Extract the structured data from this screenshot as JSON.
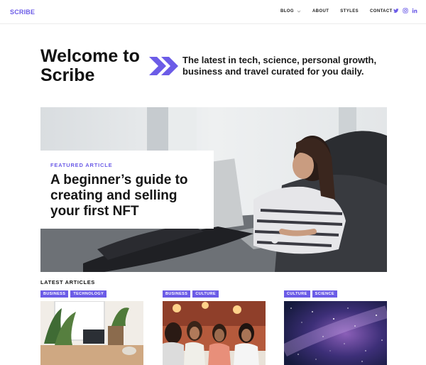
{
  "brand": {
    "name": "SCRIBE",
    "accent": "#6c5ce7"
  },
  "nav": {
    "items": [
      {
        "label": "BLOG",
        "has_dropdown": true
      },
      {
        "label": "ABOUT"
      },
      {
        "label": "STYLES"
      },
      {
        "label": "CONTACT"
      }
    ],
    "socials": [
      "twitter-icon",
      "instagram-icon",
      "linkedin-icon"
    ]
  },
  "hero": {
    "title": "Welcome to Scribe",
    "tagline": "The latest in tech, science, personal growth, business and travel curated for you daily."
  },
  "featured": {
    "label": "FEATURED ARTICLE",
    "title": "A beginner’s guide to creating and selling your first NFT"
  },
  "latest": {
    "heading": "LATEST ARTICLES",
    "articles": [
      {
        "tags": [
          "BUSINESS",
          "TECHNOLOGY"
        ]
      },
      {
        "tags": [
          "BUSINESS",
          "CULTURE"
        ]
      },
      {
        "tags": [
          "CULTURE",
          "SCIENCE"
        ]
      }
    ]
  }
}
